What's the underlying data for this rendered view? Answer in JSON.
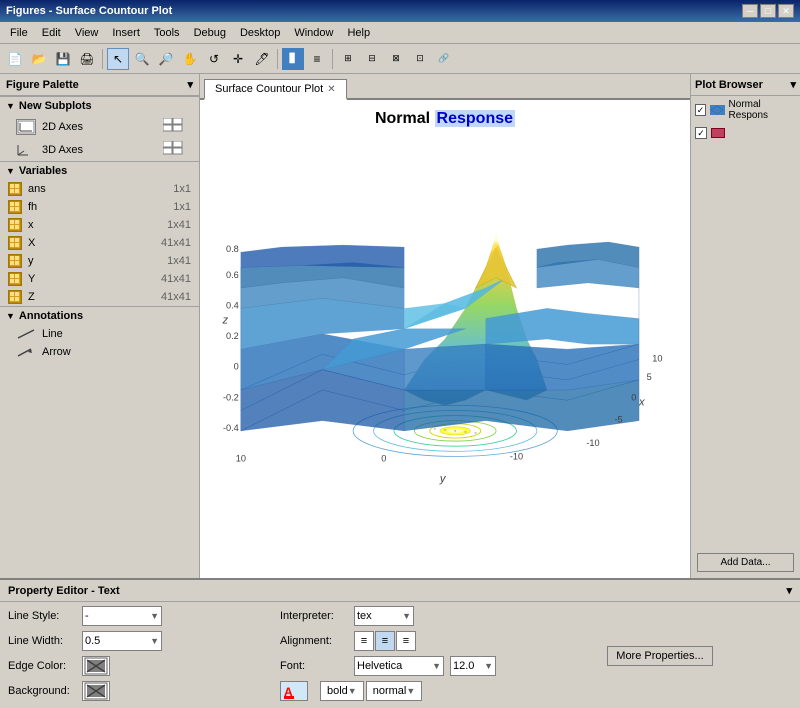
{
  "titleBar": {
    "title": "Figures - Surface Countour Plot",
    "minBtn": "─",
    "maxBtn": "□",
    "closeBtn": "✕"
  },
  "menuBar": {
    "items": [
      "File",
      "Edit",
      "View",
      "Insert",
      "Tools",
      "Debug",
      "Desktop",
      "Window",
      "Help"
    ]
  },
  "leftPanel": {
    "title": "Figure Palette",
    "sections": {
      "subplots": {
        "label": "New Subplots",
        "items": [
          {
            "label": "2D Axes",
            "type": "2d"
          },
          {
            "label": "3D Axes",
            "type": "3d"
          }
        ]
      },
      "variables": {
        "label": "Variables",
        "items": [
          {
            "name": "ans",
            "size": "1x1"
          },
          {
            "name": "fh",
            "size": "1x1"
          },
          {
            "name": "x",
            "size": "1x41"
          },
          {
            "name": "X",
            "size": "41x41"
          },
          {
            "name": "y",
            "size": "1x41"
          },
          {
            "name": "Y",
            "size": "41x41"
          },
          {
            "name": "Z",
            "size": "41x41"
          }
        ]
      },
      "annotations": {
        "label": "Annotations",
        "items": [
          "Line",
          "Arrow"
        ]
      }
    }
  },
  "tabs": [
    {
      "label": "Surface Countour Plot",
      "active": true
    }
  ],
  "plot": {
    "title": {
      "normal": "Normal",
      "highlight": "Response"
    },
    "xLabel": "x",
    "yLabel": "y",
    "zLabel": "z"
  },
  "rightPanel": {
    "title": "Plot Browser",
    "items": [
      {
        "checked": true,
        "label": "Normal Respons",
        "type": "diamond"
      },
      {
        "checked": true,
        "label": "",
        "type": "rect"
      }
    ],
    "addDataBtn": "Add Data..."
  },
  "propertyEditor": {
    "title": "Property Editor - Text",
    "lineStyle": {
      "label": "Line Style:",
      "value": "-"
    },
    "lineWidth": {
      "label": "Line Width:",
      "value": "0.5"
    },
    "edgeColor": {
      "label": "Edge Color:"
    },
    "background": {
      "label": "Background:"
    },
    "interpreter": {
      "label": "Interpreter:",
      "value": "tex"
    },
    "alignment": {
      "label": "Alignment:"
    },
    "font": {
      "label": "Font:",
      "value": "Helvetica",
      "size": "12.0"
    },
    "moreProps": "More Properties...",
    "bold": "bold",
    "normal": "normal"
  }
}
